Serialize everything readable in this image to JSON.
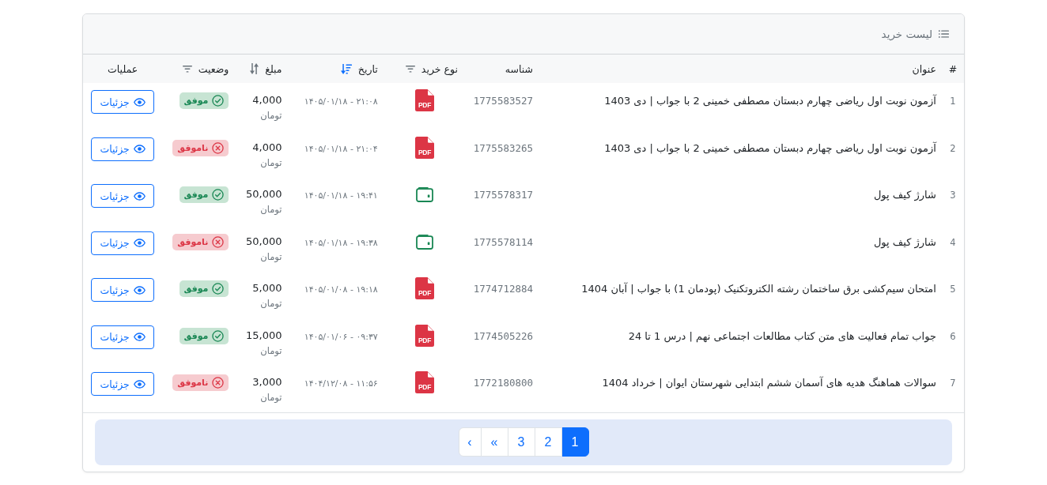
{
  "card": {
    "title": "لیست خرید"
  },
  "table": {
    "columns": [
      {
        "label": "#",
        "kind": "plain"
      },
      {
        "label": "عنوان",
        "kind": "plain"
      },
      {
        "label": "شناسه",
        "kind": "plain"
      },
      {
        "label": "نوع خرید",
        "kind": "filter"
      },
      {
        "label": "تاریخ",
        "kind": "sort",
        "sorted": true
      },
      {
        "label": "مبلغ",
        "kind": "sort",
        "sorted": false
      },
      {
        "label": "وضعیت",
        "kind": "filter"
      },
      {
        "label": "عملیات",
        "kind": "plain"
      }
    ],
    "rows": [
      {
        "number": "1",
        "title": "آزمون نوبت اول ریاضی چهارم دبستان مصطفی خمینی 2 با جواب | دی 1403",
        "id": "1775583527",
        "type": {
          "kind": "pdf",
          "label": "PDF"
        },
        "date": "۲۱:۰۸ - ۱۴۰۵/۰۱/۱۸",
        "amount": "4,000",
        "currency": "تومان",
        "status": {
          "label": "موفق",
          "successful": true
        },
        "action": "جزئیات"
      },
      {
        "number": "2",
        "title": "آزمون نوبت اول ریاضی چهارم دبستان مصطفی خمینی 2 با جواب | دی 1403",
        "id": "1775583265",
        "type": {
          "kind": "pdf",
          "label": "PDF"
        },
        "date": "۲۱:۰۴ - ۱۴۰۵/۰۱/۱۸",
        "amount": "4,000",
        "currency": "تومان",
        "status": {
          "label": "ناموفق",
          "successful": false
        },
        "action": "جزئیات"
      },
      {
        "number": "3",
        "title": "شارژ کیف پول",
        "id": "1775578317",
        "type": {
          "kind": "wallet"
        },
        "date": "۱۹:۴۱ - ۱۴۰۵/۰۱/۱۸",
        "amount": "50,000",
        "currency": "تومان",
        "status": {
          "label": "موفق",
          "successful": true
        },
        "action": "جزئیات"
      },
      {
        "number": "4",
        "title": "شارژ کیف پول",
        "id": "1775578114",
        "type": {
          "kind": "wallet"
        },
        "date": "۱۹:۳۸ - ۱۴۰۵/۰۱/۱۸",
        "amount": "50,000",
        "currency": "تومان",
        "status": {
          "label": "ناموفق",
          "successful": false
        },
        "action": "جزئیات"
      },
      {
        "number": "5",
        "title": "امتحان سیم‌کشی برق ساختمان رشته الکتروتکنیک (پودمان 1) با جواب | آبان 1404",
        "id": "1774712884",
        "type": {
          "kind": "pdf",
          "label": "PDF"
        },
        "date": "۱۹:۱۸ - ۱۴۰۵/۰۱/۰۸",
        "amount": "5,000",
        "currency": "تومان",
        "status": {
          "label": "موفق",
          "successful": true
        },
        "action": "جزئیات"
      },
      {
        "number": "6",
        "title": "جواب تمام فعالیت های متن کتاب مطالعات اجتماعی نهم | درس 1 تا 24",
        "id": "1774505226",
        "type": {
          "kind": "pdf",
          "label": "PDF"
        },
        "date": "۰۹:۳۷ - ۱۴۰۵/۰۱/۰۶",
        "amount": "15,000",
        "currency": "تومان",
        "status": {
          "label": "موفق",
          "successful": true
        },
        "action": "جزئیات"
      },
      {
        "number": "7",
        "title": "سوالات هماهنگ هدیه های آسمان ششم ابتدایی شهرستان ایوان | خرداد 1404",
        "id": "1772180800",
        "type": {
          "kind": "pdf",
          "label": "PDF"
        },
        "date": "۱۱:۵۶ - ۱۴۰۴/۱۲/۰۸",
        "amount": "3,000",
        "currency": "تومان",
        "status": {
          "label": "ناموفق",
          "successful": false
        },
        "action": "جزئیات"
      }
    ]
  },
  "pagination": [
    {
      "label": "1",
      "kind": "page",
      "selected": true
    },
    {
      "label": "2",
      "kind": "page",
      "selected": false
    },
    {
      "label": "3",
      "kind": "page",
      "selected": false
    },
    {
      "label": "«",
      "kind": "last",
      "selected": false
    },
    {
      "label": "‹",
      "kind": "next",
      "selected": false
    }
  ]
}
